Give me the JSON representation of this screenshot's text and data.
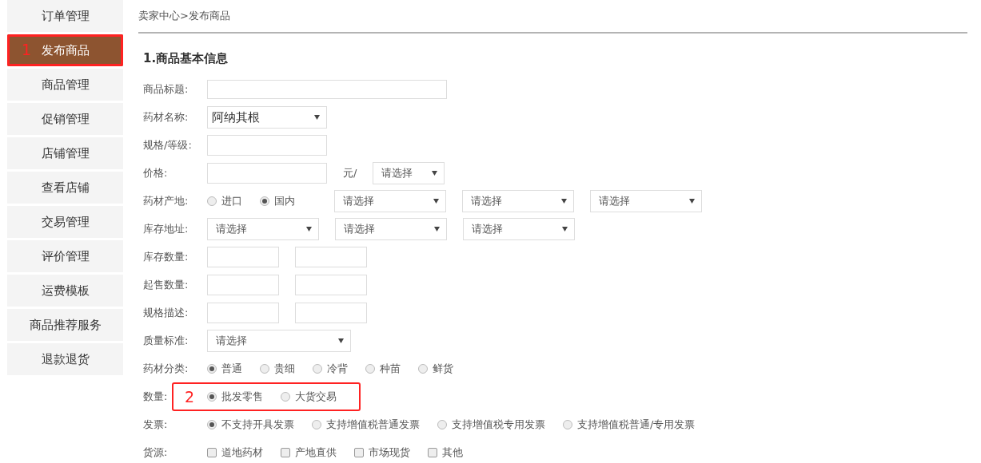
{
  "sidebar": {
    "items": [
      {
        "label": "订单管理",
        "selected": false
      },
      {
        "label": "发布商品",
        "selected": true,
        "annotation": "1"
      },
      {
        "label": "商品管理",
        "selected": false
      },
      {
        "label": "促销管理",
        "selected": false
      },
      {
        "label": "店铺管理",
        "selected": false
      },
      {
        "label": "查看店铺",
        "selected": false
      },
      {
        "label": "交易管理",
        "selected": false
      },
      {
        "label": "评价管理",
        "selected": false
      },
      {
        "label": "运费模板",
        "selected": false
      },
      {
        "label": "商品推荐服务",
        "selected": false
      },
      {
        "label": "退款退货",
        "selected": false
      }
    ]
  },
  "breadcrumb": "卖家中心>发布商品",
  "section_title": "1.商品基本信息",
  "rows": [
    {
      "kind": "long_text",
      "label": "商品标题:"
    },
    {
      "kind": "name_select",
      "label": "药材名称:",
      "value": "阿纳其根"
    },
    {
      "kind": "text",
      "label": "规格/等级:"
    },
    {
      "kind": "price",
      "label": "价格:",
      "unit": "元/",
      "select": "请选择"
    },
    {
      "kind": "radios",
      "label": "药材产地:",
      "options": [
        {
          "label": "进口",
          "selected": false
        },
        {
          "label": "国内",
          "selected": true
        }
      ],
      "selects": [
        "请选择",
        "请选择",
        "请选择"
      ]
    },
    {
      "kind": "selects",
      "label": "库存地址:",
      "selects": [
        "请选择",
        "请选择",
        "请选择"
      ]
    },
    {
      "kind": "pair",
      "label": "库存数量:"
    },
    {
      "kind": "pair",
      "label": "起售数量:"
    },
    {
      "kind": "pair",
      "label": "规格描述:"
    },
    {
      "kind": "select",
      "label": "质量标准:",
      "value": "请选择"
    },
    {
      "kind": "radios",
      "label": "药材分类:",
      "options": [
        {
          "label": "普通",
          "selected": true
        },
        {
          "label": "贵细",
          "selected": false
        },
        {
          "label": "冷背",
          "selected": false
        },
        {
          "label": "种苗",
          "selected": false
        },
        {
          "label": "鲜货",
          "selected": false
        }
      ]
    },
    {
      "kind": "radios",
      "label": "数量:",
      "annotation": "2",
      "options": [
        {
          "label": "批发零售",
          "selected": true
        },
        {
          "label": "大货交易",
          "selected": false
        }
      ]
    },
    {
      "kind": "radios",
      "label": "发票:",
      "options": [
        {
          "label": "不支持开具发票",
          "selected": true
        },
        {
          "label": "支持增值税普通发票",
          "selected": false
        },
        {
          "label": "支持增值税专用发票",
          "selected": false
        },
        {
          "label": "支持增值税普通/专用发票",
          "selected": false
        }
      ]
    },
    {
      "kind": "checks",
      "label": "货源:",
      "options": [
        {
          "label": "道地药材",
          "checked": false
        },
        {
          "label": "产地直供",
          "checked": false
        },
        {
          "label": "市场现货",
          "checked": false
        },
        {
          "label": "其他",
          "checked": false
        }
      ]
    }
  ]
}
